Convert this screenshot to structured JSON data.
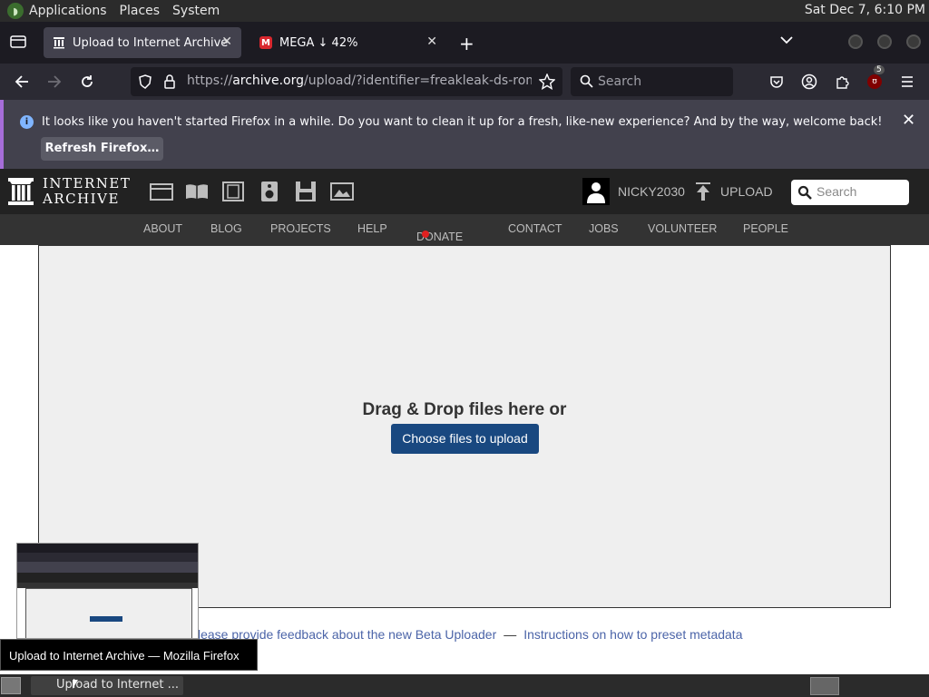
{
  "gnome_panel": {
    "menus": [
      "Applications",
      "Places",
      "System"
    ],
    "clock": "Sat Dec 7,  6:10 PM"
  },
  "browser": {
    "tabs": [
      {
        "title": "Upload to Internet Archive",
        "active": true
      },
      {
        "title": "MEGA ↓ 42%",
        "active": false
      }
    ],
    "url": {
      "prefix": "https://",
      "domain": "archive.org",
      "path": "/upload/?identifier=freakleak-ds-rom-coll"
    },
    "search_placeholder": "Search",
    "extension_badge": "5",
    "notification": {
      "message": "It looks like you haven't started Firefox in a while. Do you want to clean it up for a fresh, like-new experience? And by the way, welcome back!",
      "button": "Refresh Firefox…"
    }
  },
  "ia": {
    "logo_line1": "INTERNET",
    "logo_line2": "ARCHIVE",
    "media_icons": [
      "web-icon",
      "texts-icon",
      "video-icon",
      "audio-icon",
      "software-icon",
      "images-icon"
    ],
    "username": "NICKY2030",
    "upload_label": "UPLOAD",
    "search_placeholder": "Search",
    "nav": [
      "ABOUT",
      "BLOG",
      "PROJECTS",
      "HELP",
      "DONATE",
      "CONTACT",
      "JOBS",
      "VOLUNTEER",
      "PEOPLE"
    ],
    "drop_text": "Drag & Drop files here or",
    "choose_button": "Choose files to upload",
    "feedback_link": "lease provide feedback about the new Beta Uploader",
    "separator": "—",
    "instructions_link": "Instructions on how to preset metadata"
  },
  "taskbar": {
    "tooltip": "Upload to Internet Archive — Mozilla Firefox",
    "task_label": "Upload to Internet ..."
  },
  "colors": {
    "ia_button": "#194880",
    "link": "#4b64a8",
    "notification_accent": "#a66dd9"
  }
}
